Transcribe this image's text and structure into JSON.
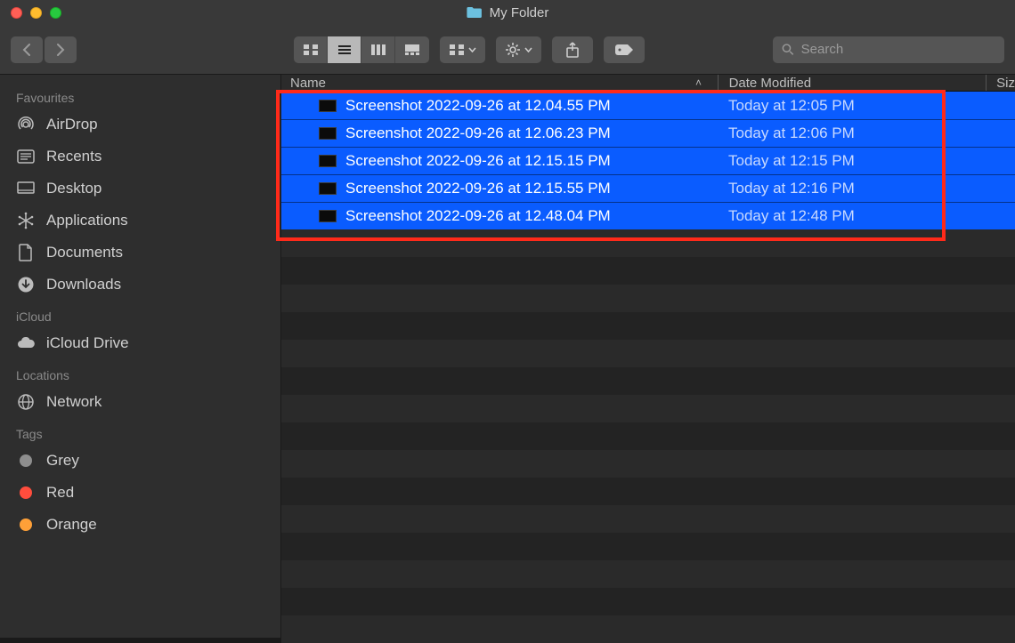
{
  "title": "My Folder",
  "search": {
    "placeholder": "Search"
  },
  "sidebar": {
    "sections": [
      {
        "header": "Favourites",
        "items": [
          {
            "label": "AirDrop"
          },
          {
            "label": "Recents"
          },
          {
            "label": "Desktop"
          },
          {
            "label": "Applications"
          },
          {
            "label": "Documents"
          },
          {
            "label": "Downloads"
          }
        ]
      },
      {
        "header": "iCloud",
        "items": [
          {
            "label": "iCloud Drive"
          }
        ]
      },
      {
        "header": "Locations",
        "items": [
          {
            "label": "Network"
          }
        ]
      },
      {
        "header": "Tags",
        "items": [
          {
            "label": "Grey",
            "color": "#8e8e8e"
          },
          {
            "label": "Red",
            "color": "#ff4d3d"
          },
          {
            "label": "Orange",
            "color": "#ffa038"
          }
        ]
      }
    ]
  },
  "columns": {
    "name": "Name",
    "date": "Date Modified",
    "size": "Siz"
  },
  "files": [
    {
      "name": "Screenshot 2022-09-26 at 12.04.55 PM",
      "date": "Today at 12:05 PM",
      "selected": true
    },
    {
      "name": "Screenshot 2022-09-26 at 12.06.23 PM",
      "date": "Today at 12:06 PM",
      "selected": true
    },
    {
      "name": "Screenshot 2022-09-26 at 12.15.15 PM",
      "date": "Today at 12:15 PM",
      "selected": true
    },
    {
      "name": "Screenshot 2022-09-26 at 12.15.55 PM",
      "date": "Today at 12:16 PM",
      "selected": true
    },
    {
      "name": "Screenshot 2022-09-26 at 12.48.04 PM",
      "date": "Today at 12:48 PM",
      "selected": true
    }
  ]
}
